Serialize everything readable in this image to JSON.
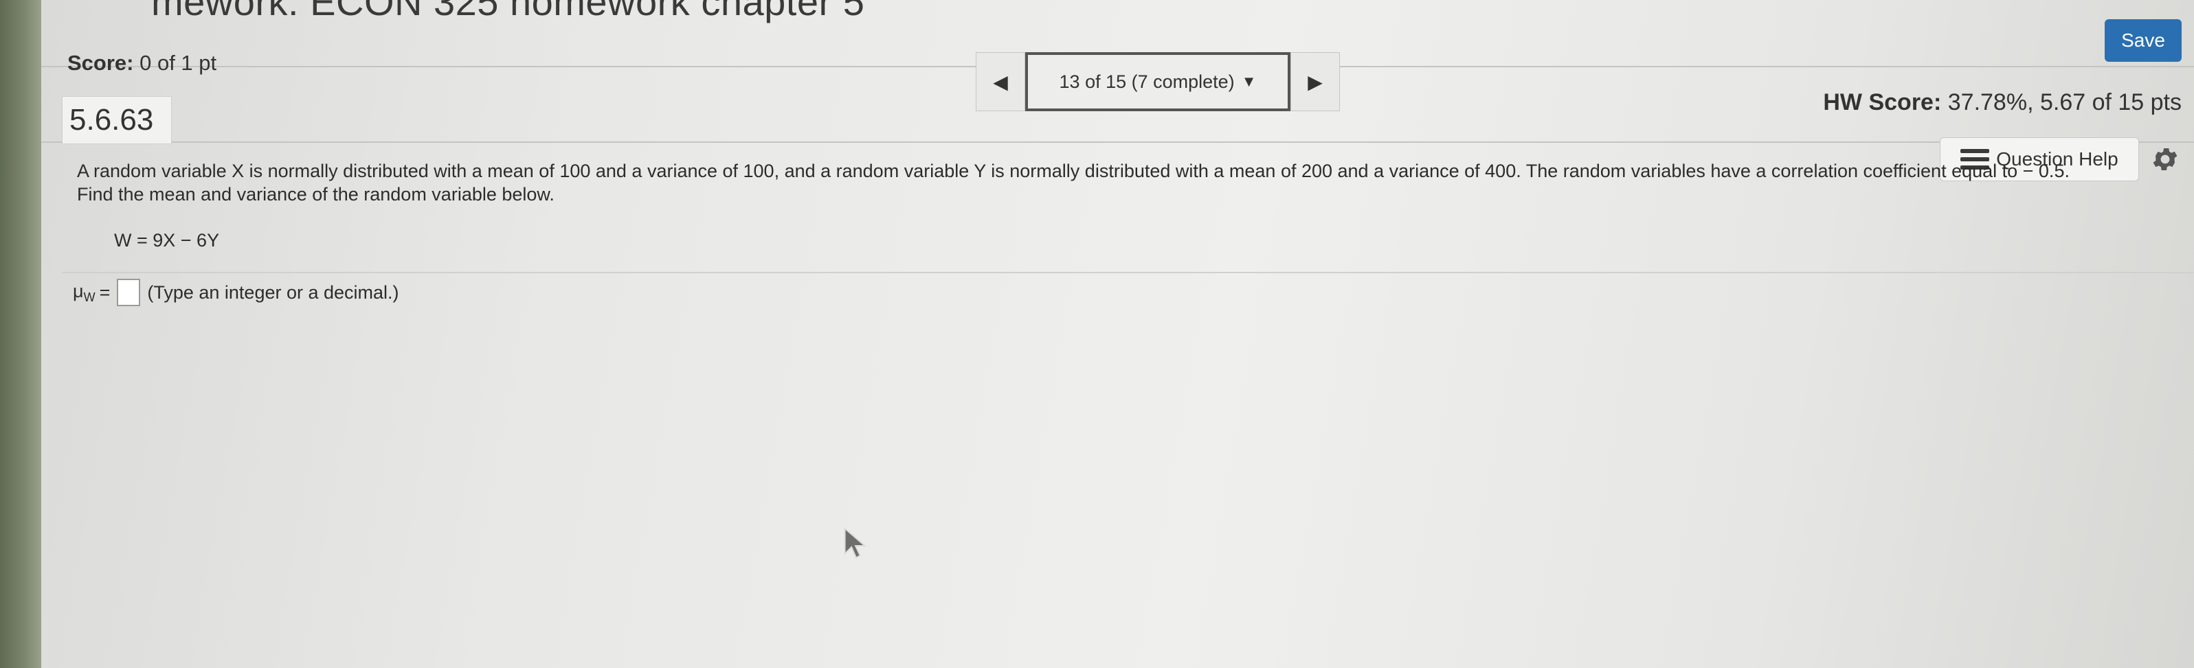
{
  "header": {
    "title": "mework: ECON 325 homework chapter 5",
    "save_label": "Save"
  },
  "score": {
    "label": "Score:",
    "value": "0 of 1 pt"
  },
  "nav": {
    "prev_icon": "chevron-left-icon",
    "position_label": "13 of 15 (7 complete)",
    "dropdown_icon": "caret-down-icon",
    "next_icon": "chevron-right-icon"
  },
  "hw_score": {
    "label": "HW Score:",
    "value": "37.78%, 5.67 of 15 pts"
  },
  "question": {
    "id": "5.6.63",
    "help_label": "Question Help",
    "help_icon": "list-icon",
    "settings_icon": "gear-icon",
    "text_line1": "A random variable X is normally distributed with a mean of 100 and a variance of 100, and a random variable Y is normally distributed with a mean of 200 and a variance of 400. The random variables have a correlation coefficient equal to  − 0.5.",
    "text_line2": "Find the mean and variance of the random variable below.",
    "formula": "W = 9X − 6Y",
    "answer_mu": "μ",
    "answer_sub": "W",
    "answer_eq": "=",
    "answer_hint": "(Type an integer or a decimal.)"
  },
  "colors": {
    "save_button": "#2a6fb1",
    "background": "#ececea"
  }
}
